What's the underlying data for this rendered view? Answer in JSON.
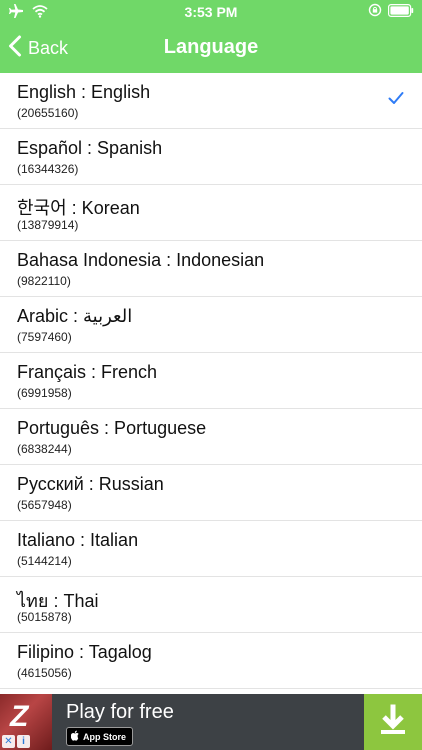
{
  "status_bar": {
    "time": "3:53 PM"
  },
  "nav": {
    "back_label": "Back",
    "title": "Language"
  },
  "theme": {
    "header_color": "#70d868",
    "check_color": "#2f7cf6",
    "ad_background": "#3d4145",
    "ad_download_color": "#8dc63f"
  },
  "languages": [
    {
      "label": "English : English",
      "count": "(20655160)",
      "selected": true
    },
    {
      "label": "Español : Spanish",
      "count": "(16344326)",
      "selected": false
    },
    {
      "label": "한국어 : Korean",
      "count": "(13879914)",
      "selected": false
    },
    {
      "label": "Bahasa Indonesia : Indonesian",
      "count": "(9822110)",
      "selected": false
    },
    {
      "label": "Arabic : العربية",
      "count": "(7597460)",
      "selected": false
    },
    {
      "label": "Français : French",
      "count": "(6991958)",
      "selected": false
    },
    {
      "label": "Português : Portuguese",
      "count": "(6838244)",
      "selected": false
    },
    {
      "label": "Русский : Russian",
      "count": "(5657948)",
      "selected": false
    },
    {
      "label": "Italiano : Italian",
      "count": "(5144214)",
      "selected": false
    },
    {
      "label": "ไทย : Thai",
      "count": "(5015878)",
      "selected": false
    },
    {
      "label": "Filipino : Tagalog",
      "count": "(4615056)",
      "selected": false
    }
  ],
  "ad": {
    "headline": "Play for free",
    "store_badge": "App Store",
    "icons": [
      "airplane-mode-icon",
      "wifi-icon",
      "orientation-lock-icon",
      "battery-icon",
      "checkmark-icon",
      "download-icon"
    ]
  }
}
